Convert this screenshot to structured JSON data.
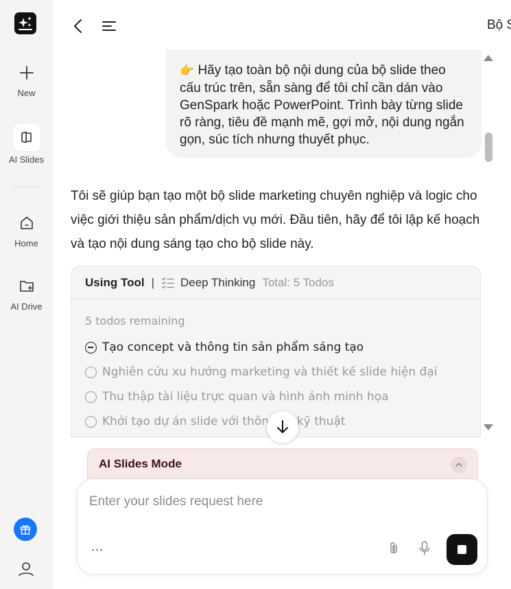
{
  "sidebar": {
    "logo_icon": "sparkle-logo-icon",
    "items": [
      {
        "label": "New",
        "icon": "plus-icon"
      },
      {
        "label": "AI Slides",
        "icon": "slides-icon"
      },
      {
        "label": "Home",
        "icon": "home-icon"
      },
      {
        "label": "AI Drive",
        "icon": "folder-icon"
      }
    ],
    "gift_icon": "gift-icon",
    "profile_icon": "user-icon"
  },
  "header": {
    "title": "Bộ S"
  },
  "conversation": {
    "user_emoji": "👉",
    "user_message": "Hãy tạo toàn bộ nội dung của bộ slide theo cấu trúc trên, sẵn sàng để tôi chỉ cần dán vào GenSpark hoặc PowerPoint. Trình bày từng slide rõ ràng, tiêu đề mạnh mẽ, gợi mở, nội dung ngắn gọn, súc tích nhưng thuyết phục.",
    "assistant_message": "Tôi sẽ giúp bạn tạo một bộ slide marketing chuyên nghiệp và logic cho việc giới thiệu sản phẩm/dịch vụ mới. Đầu tiên, hãy để tôi lập kế hoạch và tạo nội dung sáng tạo cho bộ slide này."
  },
  "tool": {
    "using_label": "Using Tool",
    "separator": "|",
    "tool_name": "Deep Thinking",
    "total": "Total: 5 Todos",
    "remaining": "5 todos remaining",
    "todos": [
      {
        "text": "Tạo concept và thông tin sản phẩm sáng tạo",
        "status": "in-progress"
      },
      {
        "text": "Nghiên cứu xu hướng marketing và thiết kế slide hiện đại",
        "status": "pending"
      },
      {
        "text": "Thu thập tài liệu trực quan và hình ảnh minh họa",
        "status": "pending"
      },
      {
        "text": "Khởi tạo dự án slide với thông số kỹ thuật",
        "status": "pending"
      }
    ]
  },
  "mode": {
    "title": "AI Slides Mode"
  },
  "input": {
    "placeholder": "Enter your slides request here",
    "value": "",
    "more_label": "..."
  },
  "colors": {
    "accent_blue": "#1677ff",
    "mode_background": "#f7e9ea",
    "mode_text": "#3c0f1e",
    "stop_button": "#111111"
  }
}
